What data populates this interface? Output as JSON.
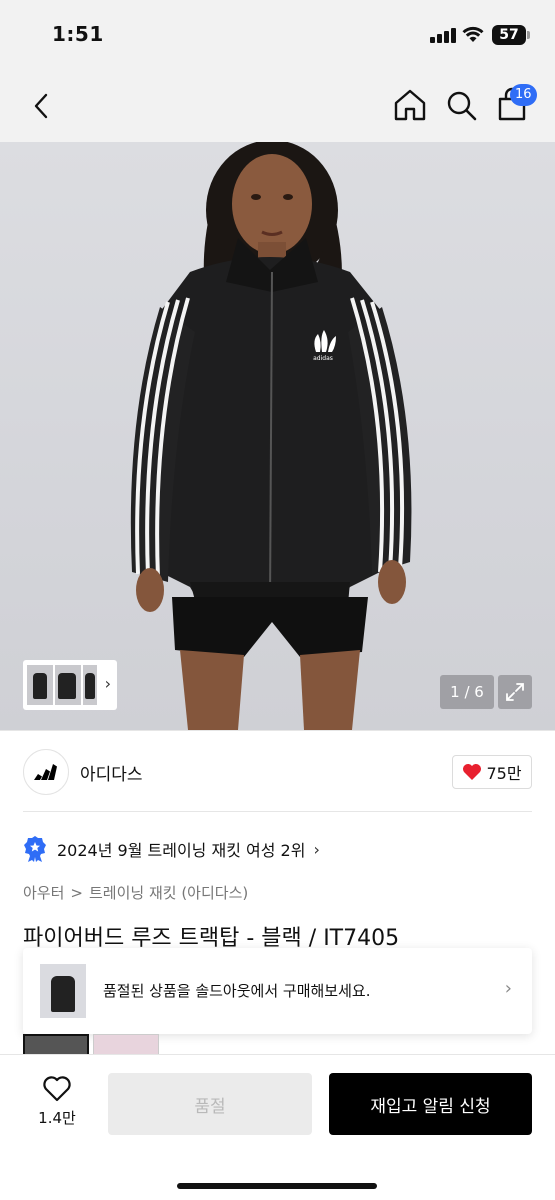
{
  "status_bar": {
    "time": "1:51",
    "battery": "57"
  },
  "nav": {
    "cart_count": "16"
  },
  "gallery": {
    "counter": "1 / 6"
  },
  "brand": {
    "name": "아디다스",
    "likes": "75만"
  },
  "ranking": {
    "text": "2024년 9월 트레이닝 재킷 여성 2위"
  },
  "breadcrumb": {
    "category": "아우터",
    "separator": ">",
    "subcategory": "트레이닝 재킷 (아디다스)"
  },
  "product": {
    "title": "파이어버드 루즈 트랙탑 - 블랙 / IT7405",
    "logo_text": "adidas"
  },
  "soldout_banner": {
    "text": "품절된 상품을 솔드아웃에서 구매해보세요."
  },
  "bottom_bar": {
    "wish_count": "1.4만",
    "soldout_label": "품절",
    "restock_label": "재입고 알림 신청"
  },
  "colors": {
    "accent": "#2f6df6",
    "heart": "#e8202f",
    "primary_button": "#000000"
  }
}
